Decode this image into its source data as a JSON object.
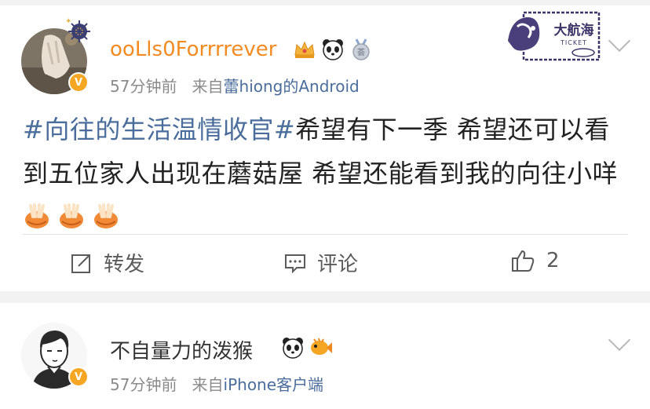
{
  "post1": {
    "username": "ooLls0Forrrrever",
    "time": "57分钟前",
    "source_prefix": "来自",
    "source_device": "蕾hiong的Android",
    "topic": "#向往的生活温情收官#",
    "text": "希望有下一季  希望还可以看到五位家人出现在蘑菇屋  希望还能看到我的向往小咩",
    "stamp_text": "大航海",
    "stamp_subtext": "TICKET",
    "actions": {
      "repost_label": "转发",
      "comment_label": "评论",
      "like_count": "2"
    }
  },
  "post2": {
    "username": "不自量力的泼猴",
    "time": "57分钟前",
    "source_prefix": "来自",
    "source_device": "iPhone客户端"
  },
  "colors": {
    "background": "#f2f2f2",
    "username_orange": "#f28b22",
    "link_blue": "#4a6d9c",
    "meta_gray": "#8a8a8a",
    "verified_badge": "#f5a623"
  },
  "icons": [
    "crown-icon",
    "panda-icon",
    "medal-icon",
    "fish-icon",
    "repost-icon",
    "comment-icon",
    "like-icon",
    "chevron-down-icon",
    "hand-emoji-icon"
  ]
}
